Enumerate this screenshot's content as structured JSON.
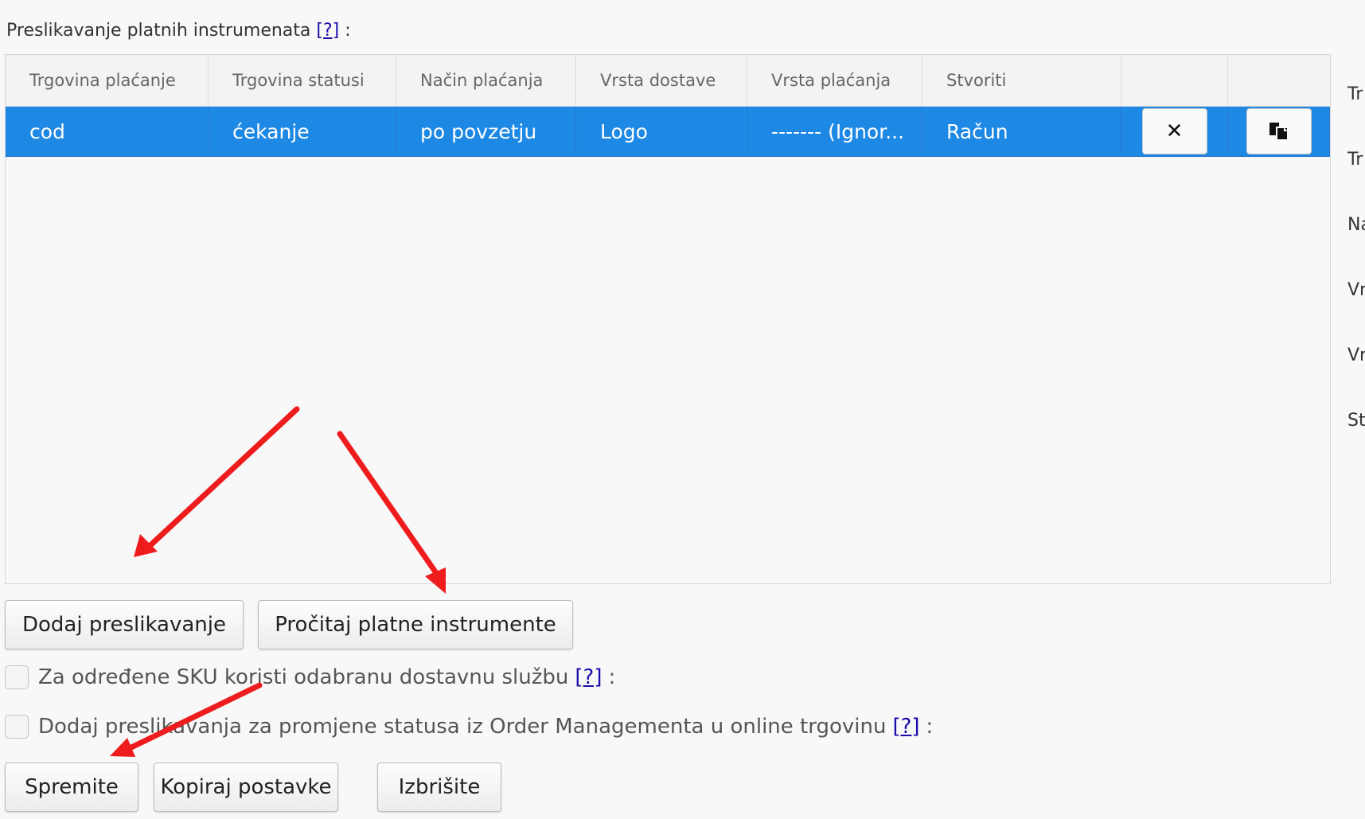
{
  "section": {
    "title": "Preslikavanje platnih instrumenata",
    "help": "[?]",
    "colon": ":"
  },
  "grid": {
    "headers": [
      "Trgovina plaćanje",
      "Trgovina statusi",
      "Način plaćanja",
      "Vrsta dostave",
      "Vrsta plaćanja",
      "Stvoriti",
      "",
      ""
    ],
    "rows": [
      {
        "shop_payment": "cod",
        "shop_status": "ćekanje",
        "payment_method": "po povzetju",
        "delivery_type": "Logo",
        "payment_type": "------- (Ignor...",
        "create": "Račun",
        "delete_icon": "close-icon",
        "copy_icon": "copy-icon",
        "selected": true
      }
    ],
    "row_color": "#1e88e5"
  },
  "actions": {
    "add_mapping": "Dodaj preslikavanje",
    "read_instruments": "Pročitaj platne instrumente"
  },
  "options": {
    "sku_label": "Za određene SKU koristi odabranu dostavnu službu",
    "sku_help": "[?]",
    "sku_colon": ":",
    "sku_checked": false,
    "status_label": "Dodaj preslikavanja za promjene statusa iz Order Managementa u online trgovinu",
    "status_help": "[?]",
    "status_colon": ":",
    "status_checked": false
  },
  "footer": {
    "save": "Spremite",
    "copy_settings": "Kopiraj postavke",
    "delete": "Izbrišite"
  },
  "side_panel": {
    "labels": [
      "Tr",
      "Tr",
      "Na",
      "Vr",
      "Vr",
      "St"
    ]
  },
  "annotation_color": "#ee1c1c"
}
